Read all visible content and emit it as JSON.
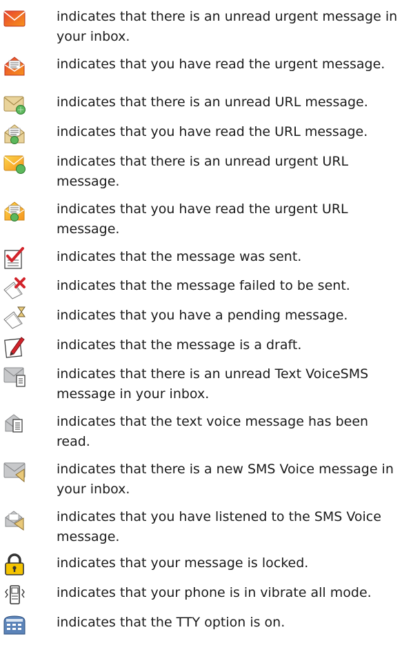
{
  "legend": [
    {
      "icon": "urgent-unread-message-icon",
      "text": "indicates that there is an unread urgent message in your inbox."
    },
    {
      "icon": "urgent-read-message-icon",
      "text": "indicates that you have read the urgent message."
    },
    {
      "icon": "url-unread-message-icon",
      "text": "indicates that there is an unread URL message."
    },
    {
      "icon": "url-read-message-icon",
      "text": "indicates that you have read the URL message."
    },
    {
      "icon": "urgent-url-unread-message-icon",
      "text": "indicates that there is an unread urgent URL message."
    },
    {
      "icon": "urgent-url-read-message-icon",
      "text": "indicates that you have read the urgent URL message."
    },
    {
      "icon": "sent-message-icon",
      "text": "indicates that the message was sent."
    },
    {
      "icon": "failed-message-icon",
      "text": "indicates that the message failed to be sent."
    },
    {
      "icon": "pending-message-icon",
      "text": "indicates that you have a pending message."
    },
    {
      "icon": "draft-message-icon",
      "text": "indicates that the message is a draft."
    },
    {
      "icon": "text-voicesms-unread-icon",
      "text": "indicates that there is an unread Text VoiceSMS message in your inbox."
    },
    {
      "icon": "text-voice-read-icon",
      "text": "indicates that the text voice message has been read."
    },
    {
      "icon": "sms-voice-new-icon",
      "text": "indicates that there is a new SMS Voice message in your inbox."
    },
    {
      "icon": "sms-voice-listened-icon",
      "text": "indicates that you have listened to the SMS Voice message."
    },
    {
      "icon": "locked-message-icon",
      "text": "indicates that your message is locked."
    },
    {
      "icon": "vibrate-all-icon",
      "text": "indicates that your phone is in vibrate all mode."
    },
    {
      "icon": "tty-icon",
      "text": "indicates that the TTY option is on."
    }
  ],
  "colors": {
    "urgent_red": "#e8432e",
    "urgent_orange": "#f7941d",
    "envelope_tan": "#e9d39a",
    "url_green": "#5cb85c",
    "sms_grey": "#c7c8ca",
    "lock_yellow": "#f5c400",
    "tty_blue": "#5b83b8",
    "check_red": "#d2232a"
  }
}
